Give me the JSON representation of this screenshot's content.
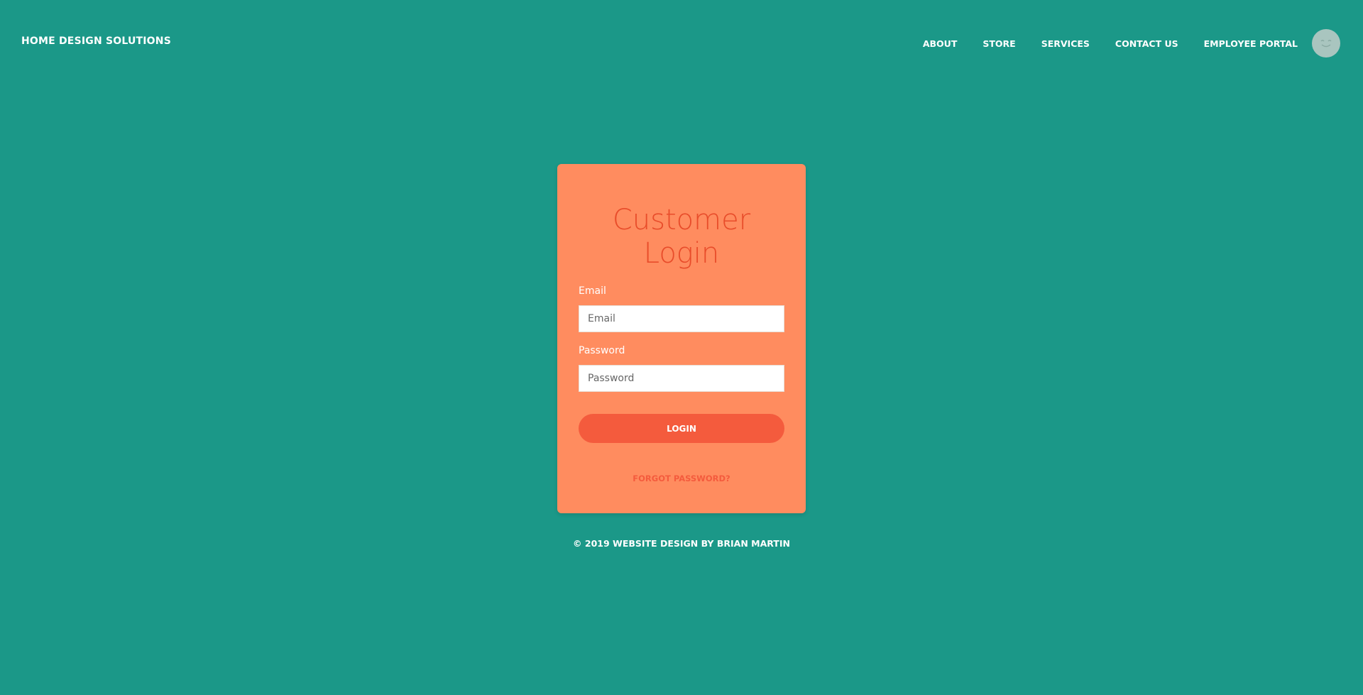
{
  "brand": {
    "title": "HOME DESIGN SOLUTIONS"
  },
  "nav": {
    "items": [
      {
        "label": "ABOUT"
      },
      {
        "label": "STORE"
      },
      {
        "label": "SERVICES"
      },
      {
        "label": "CONTACT US"
      },
      {
        "label": "EMPLOYEE PORTAL"
      }
    ],
    "avatar_icon": "smiley-face-icon"
  },
  "login": {
    "title_line1": "Customer",
    "title_line2": "Login",
    "email_label": "Email",
    "email_placeholder": "Email",
    "email_value": "",
    "password_label": "Password",
    "password_placeholder": "Password",
    "password_value": "",
    "login_button": "LOGIN",
    "forgot_link": "FORGOT PASSWORD?"
  },
  "footer": {
    "text": "© 2019 WEBSITE DESIGN BY BRIAN MARTIN"
  },
  "colors": {
    "background": "#1b9888",
    "card": "#ff8c5f",
    "accent": "#f45b3d",
    "title": "#e84c2a"
  }
}
